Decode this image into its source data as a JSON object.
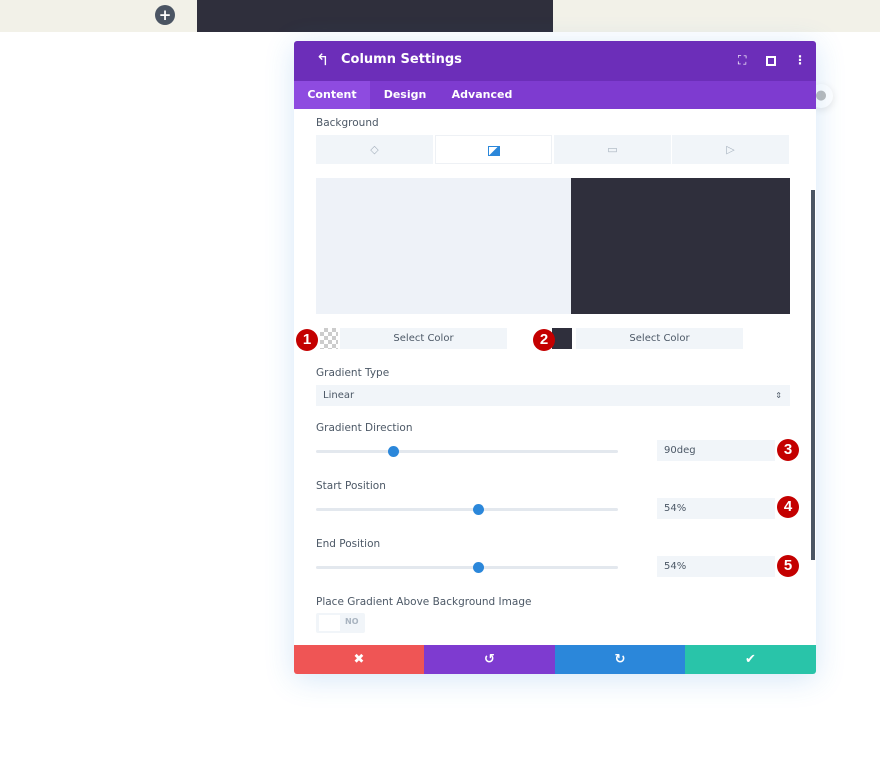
{
  "page": {
    "add_icon": "+"
  },
  "modal": {
    "title": "Column Settings",
    "back_icon": "↰",
    "header_icons": [
      "fullscreen-icon",
      "split-view-icon",
      "more-icon"
    ],
    "tabs": [
      {
        "label": "Content",
        "active": true
      },
      {
        "label": "Design"
      },
      {
        "label": "Advanced"
      }
    ],
    "background": {
      "label": "Background",
      "type_tabs": [
        "color",
        "gradient",
        "image",
        "video"
      ],
      "active_type": "gradient",
      "preview_colors": {
        "start": "#eef2f8",
        "end": "#2f2f3c"
      },
      "color1": {
        "button": "Select Color",
        "swatch": "transparent"
      },
      "color2": {
        "button": "Select Color",
        "swatch": "#2f2f3c"
      }
    },
    "gradient_type": {
      "label": "Gradient Type",
      "value": "Linear"
    },
    "gradient_direction": {
      "label": "Gradient Direction",
      "value": "90deg",
      "slider_percent": 25
    },
    "start_position": {
      "label": "Start Position",
      "value": "54%",
      "slider_percent": 54
    },
    "end_position": {
      "label": "End Position",
      "value": "54%",
      "slider_percent": 54
    },
    "place_above": {
      "label": "Place Gradient Above Background Image",
      "toggle": "NO"
    },
    "badges": [
      "1",
      "2",
      "3",
      "4",
      "5"
    ],
    "footer": {
      "cancel": "✖",
      "undo": "↺",
      "redo": "↻",
      "save": "✔"
    }
  },
  "colors": {
    "header": "#6c2eb9",
    "tabs": "#7e3bd0",
    "cancel": "#ef5555",
    "undo": "#7e3bd0",
    "redo": "#2b87da",
    "save": "#29c4a9",
    "badge": "#c40000"
  }
}
